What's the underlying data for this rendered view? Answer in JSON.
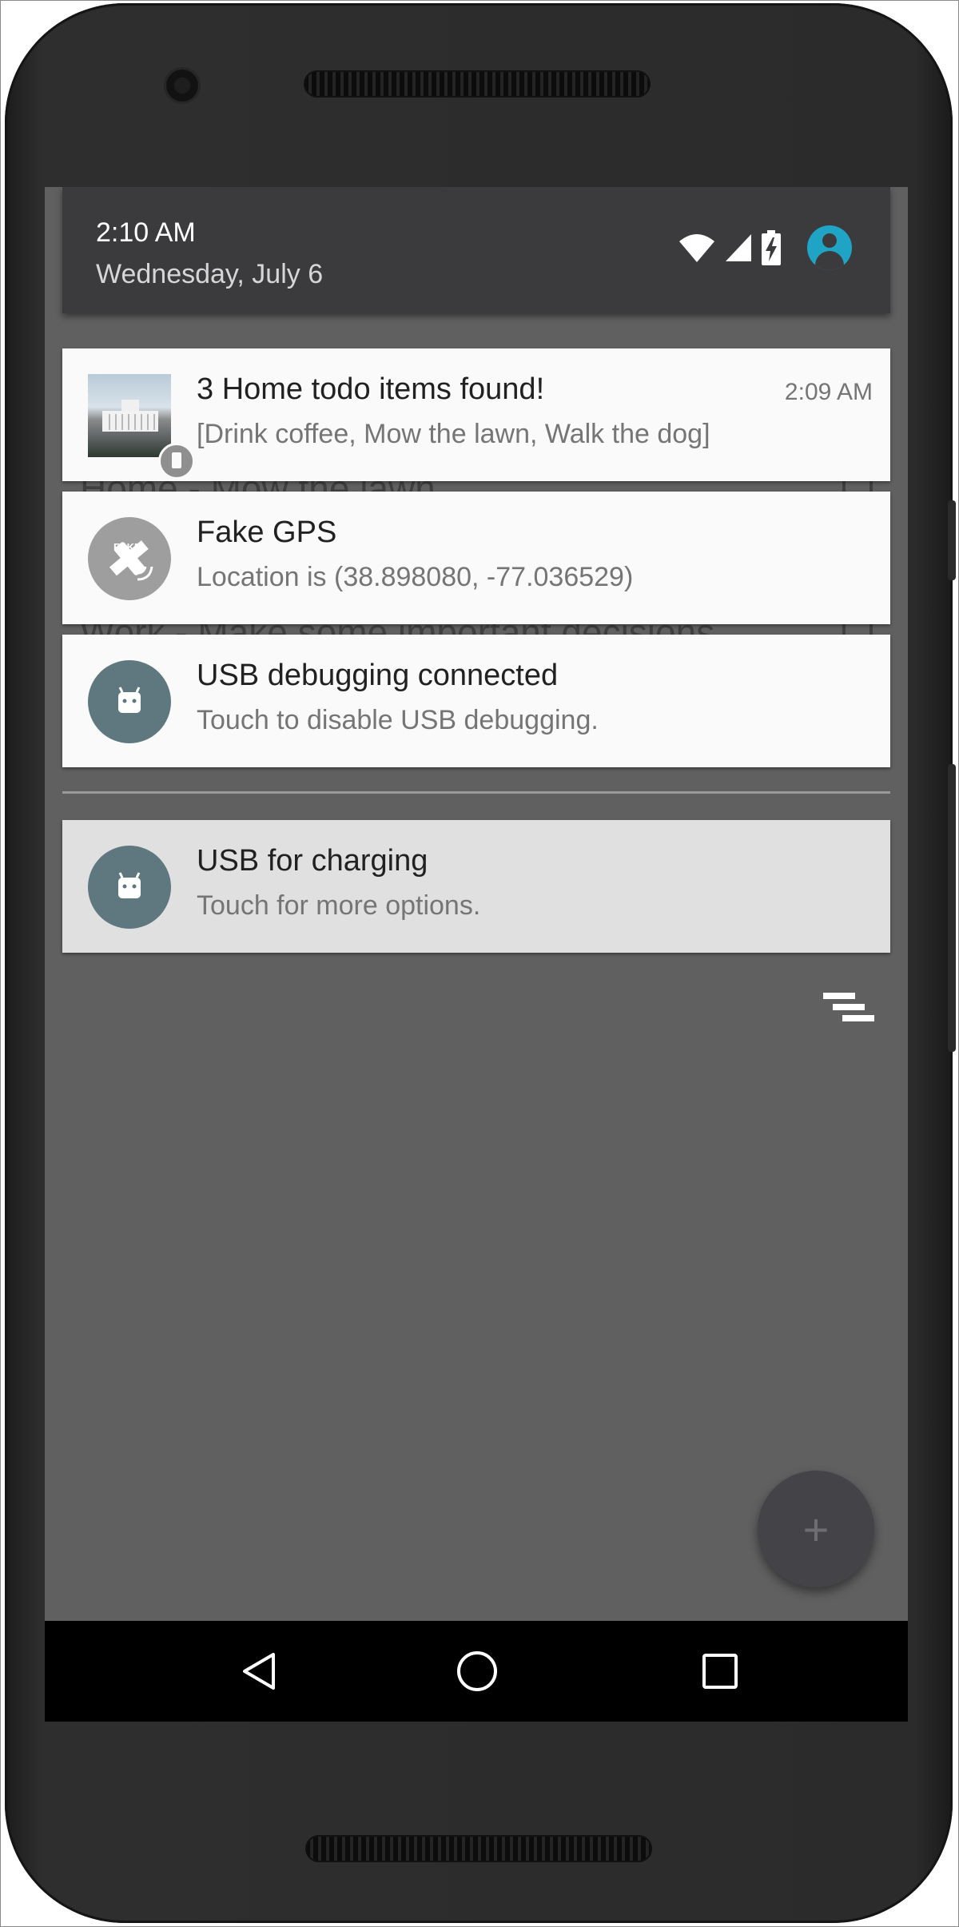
{
  "status": {
    "time": "2:10 AM",
    "date": "Wednesday, July 6",
    "icons": [
      "wifi-icon",
      "cell-signal-icon",
      "battery-charging-icon",
      "account-icon"
    ]
  },
  "background_app": {
    "items": [
      "Home - Mow the lawn",
      "Work - Make some important decisions"
    ]
  },
  "notifications": [
    {
      "title": "3 Home todo items found!",
      "text": "[Drink coffee, Mow the lawn, Walk the dog]",
      "time": "2:09 AM",
      "icon": "white-house-thumbnail"
    },
    {
      "title": "Fake GPS",
      "text": "Location is (38.898080, -77.036529)",
      "icon": "fake-gps-satellite-icon",
      "icon_label": "FAKE"
    },
    {
      "title": "USB debugging connected",
      "text": "Touch to disable USB debugging.",
      "icon": "android-icon"
    },
    {
      "title": "USB for charging",
      "text": "Touch for more options.",
      "icon": "android-icon"
    }
  ],
  "fab": {
    "label": "+"
  },
  "colors": {
    "header": "#3b3b3e",
    "avatar": "#20a4c5",
    "shade": "#606060",
    "card": "#fafafa",
    "card_alt": "#e0e0e0",
    "android_circle": "#5f7880"
  }
}
